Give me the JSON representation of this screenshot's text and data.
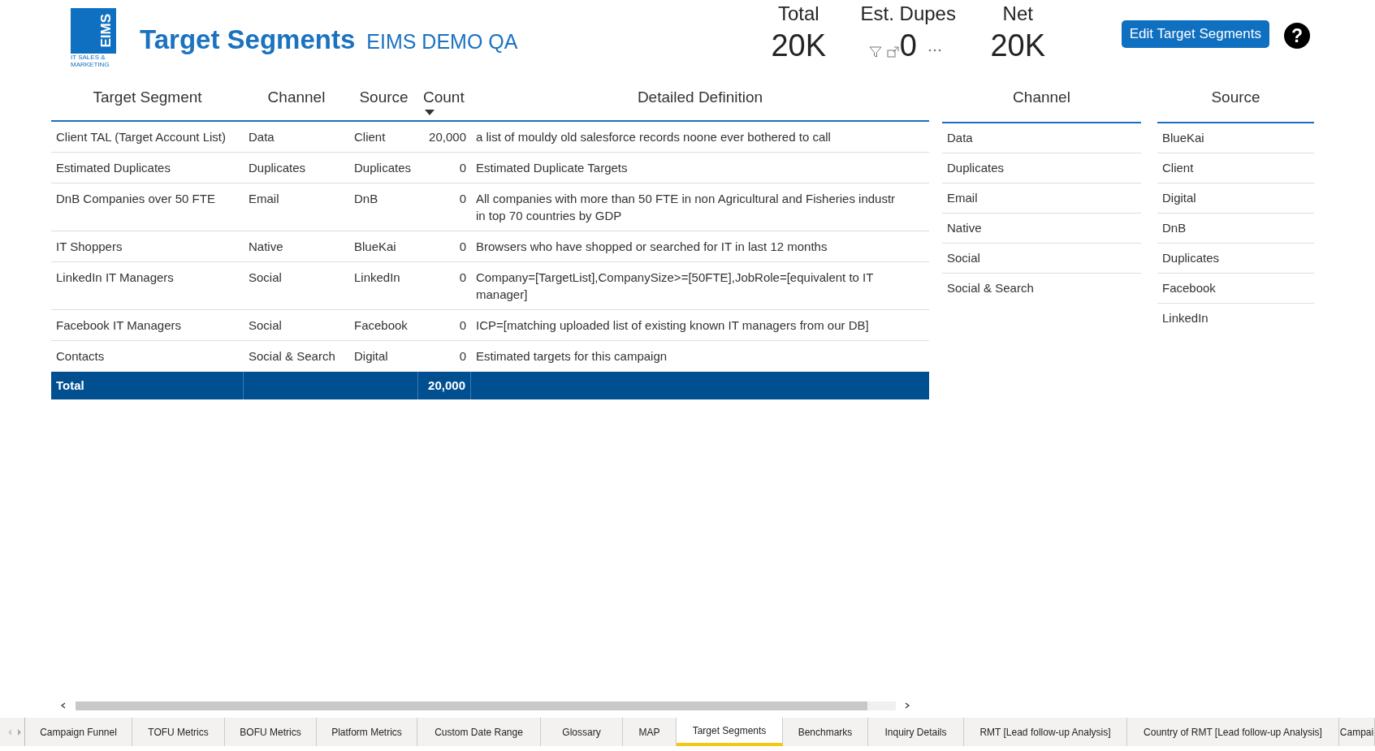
{
  "header": {
    "logo": {
      "mark": "EIMS",
      "caption": "IT SALES & MARKETING"
    },
    "title": "Target Segments",
    "subtitle": "EIMS DEMO QA"
  },
  "cards": [
    {
      "label": "Total",
      "value": "20K",
      "kind": "plain"
    },
    {
      "label": "Est. Dupes",
      "value": "0",
      "kind": "hovered"
    },
    {
      "label": "Net",
      "value": "20K",
      "kind": "plain"
    }
  ],
  "edit_button": "Edit Target Segments",
  "help": "?",
  "table": {
    "columns": [
      {
        "label": "Target Segment",
        "sorted": false
      },
      {
        "label": "Channel",
        "sorted": false
      },
      {
        "label": "Source",
        "sorted": false
      },
      {
        "label": "Count",
        "sorted": true
      },
      {
        "label": "Detailed Definition",
        "sorted": false
      }
    ],
    "rows": [
      {
        "segment": "Client TAL (Target Account List)",
        "channel": "Data",
        "source": "Client",
        "count": "20,000",
        "definition": [
          "a list of mouldy old salesforce records noone ever bothered to call"
        ]
      },
      {
        "segment": "Estimated Duplicates",
        "channel": "Duplicates",
        "source": "Duplicates",
        "count": "0",
        "definition": [
          "Estimated Duplicate Targets"
        ]
      },
      {
        "segment": "DnB Companies over 50 FTE",
        "channel": "Email",
        "source": "DnB",
        "count": "0",
        "definition": [
          "All companies with more than 50 FTE in non Agricultural and Fisheries industr",
          "in top 70 countries by GDP"
        ]
      },
      {
        "segment": "IT Shoppers",
        "channel": "Native",
        "source": "BlueKai",
        "count": "0",
        "definition": [
          "Browsers who have shopped or searched for IT in last 12 months"
        ]
      },
      {
        "segment": "LinkedIn IT Managers",
        "channel": "Social",
        "source": "LinkedIn",
        "count": "0",
        "definition": [
          "Company=[TargetList],CompanySize>=[50FTE],JobRole=[equivalent to IT",
          "manager]"
        ]
      },
      {
        "segment": "Facebook IT Managers",
        "channel": "Social",
        "source": "Facebook",
        "count": "0",
        "definition": [
          "ICP=[matching uploaded list of existing known IT managers from our DB]"
        ]
      },
      {
        "segment": "Contacts",
        "channel": "Social & Search",
        "source": "Digital",
        "count": "0",
        "definition": [
          "Estimated targets for this campaign"
        ]
      }
    ],
    "total": {
      "label": "Total",
      "count": "20,000"
    }
  },
  "slicers": [
    {
      "title": "Channel",
      "items": [
        "Data",
        "Duplicates",
        "Email",
        "Native",
        "Social",
        "Social & Search"
      ]
    },
    {
      "title": "Source",
      "items": [
        "BlueKai",
        "Client",
        "Digital",
        "DnB",
        "Duplicates",
        "Facebook",
        "LinkedIn"
      ]
    }
  ],
  "page_tabs": [
    {
      "label": "Campaign Funnel",
      "selected": false
    },
    {
      "label": "TOFU Metrics",
      "selected": false
    },
    {
      "label": "BOFU Metrics",
      "selected": false
    },
    {
      "label": "Platform Metrics",
      "selected": false
    },
    {
      "label": "Custom Date Range",
      "selected": false
    },
    {
      "label": "Glossary",
      "selected": false
    },
    {
      "label": "MAP",
      "selected": false
    },
    {
      "label": "Target Segments",
      "selected": true
    },
    {
      "label": "Benchmarks",
      "selected": false
    },
    {
      "label": "Inquiry Details",
      "selected": false
    },
    {
      "label": "RMT [Lead follow-up Analysis]",
      "selected": false
    },
    {
      "label": "Country of RMT [Lead follow-up Analysis]",
      "selected": false
    },
    {
      "label": "Campai",
      "selected": false
    }
  ]
}
